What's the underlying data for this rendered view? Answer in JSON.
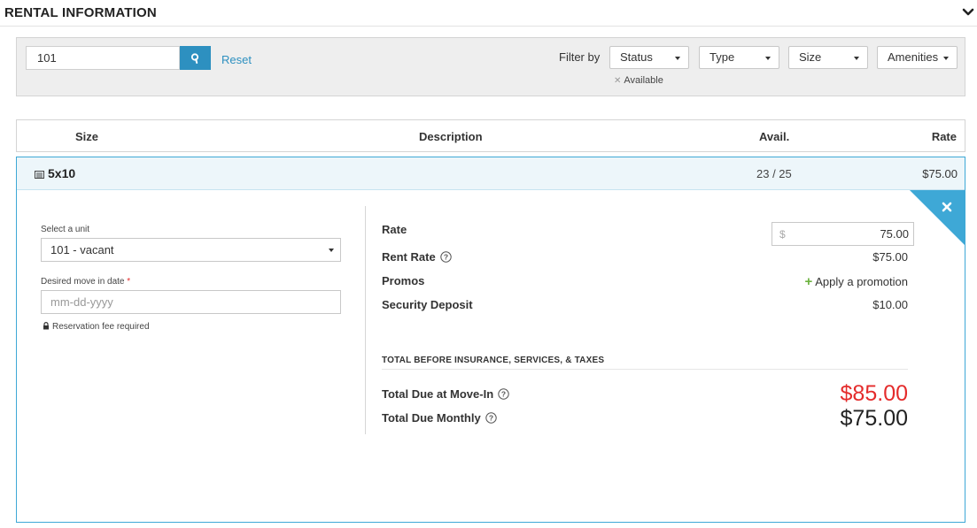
{
  "header": {
    "title": "RENTAL INFORMATION",
    "collapse_icon": "chevron-down-icon"
  },
  "filters": {
    "search_value": "101",
    "search_icon": "search-icon",
    "reset_label": "Reset",
    "filter_by_label": "Filter by",
    "buttons": [
      "Status",
      "Type",
      "Size",
      "Amenities"
    ],
    "active_tags": [
      {
        "label": "Available",
        "remove_icon": "x-icon"
      }
    ]
  },
  "table": {
    "columns": [
      "Size",
      "Description",
      "Avail.",
      "Rate"
    ]
  },
  "unit_row": {
    "size": "5x10",
    "size_icon": "storage-unit-icon",
    "avail": "23 / 25",
    "rate": "$75.00",
    "close_icon": "close-icon"
  },
  "form": {
    "select_unit_label": "Select a unit",
    "select_unit_value": "101 - vacant",
    "move_in_label": "Desired move in date",
    "required_marker": "*",
    "move_in_placeholder": "mm-dd-yyyy",
    "fee_note": "Reservation fee required",
    "fee_icon": "lock-icon"
  },
  "pricing": {
    "rate_label": "Rate",
    "rate_currency": "$",
    "rate_input_value": "75.00",
    "rent_rate_label": "Rent Rate",
    "rent_rate_value": "$75.00",
    "promos_label": "Promos",
    "apply_promo_label": "Apply a promotion",
    "security_deposit_label": "Security Deposit",
    "security_deposit_value": "$10.00",
    "section_caption": "TOTAL BEFORE INSURANCE, SERVICES, & TAXES",
    "total_move_in_label": "Total Due at Move-In",
    "total_move_in_value": "$85.00",
    "total_monthly_label": "Total Due Monthly",
    "total_monthly_value": "$75.00"
  },
  "colors": {
    "accent": "#2d90c0",
    "due_red": "#e42b2b",
    "promo_green": "#6cb33f",
    "corner_blue": "#3ea8d6"
  }
}
